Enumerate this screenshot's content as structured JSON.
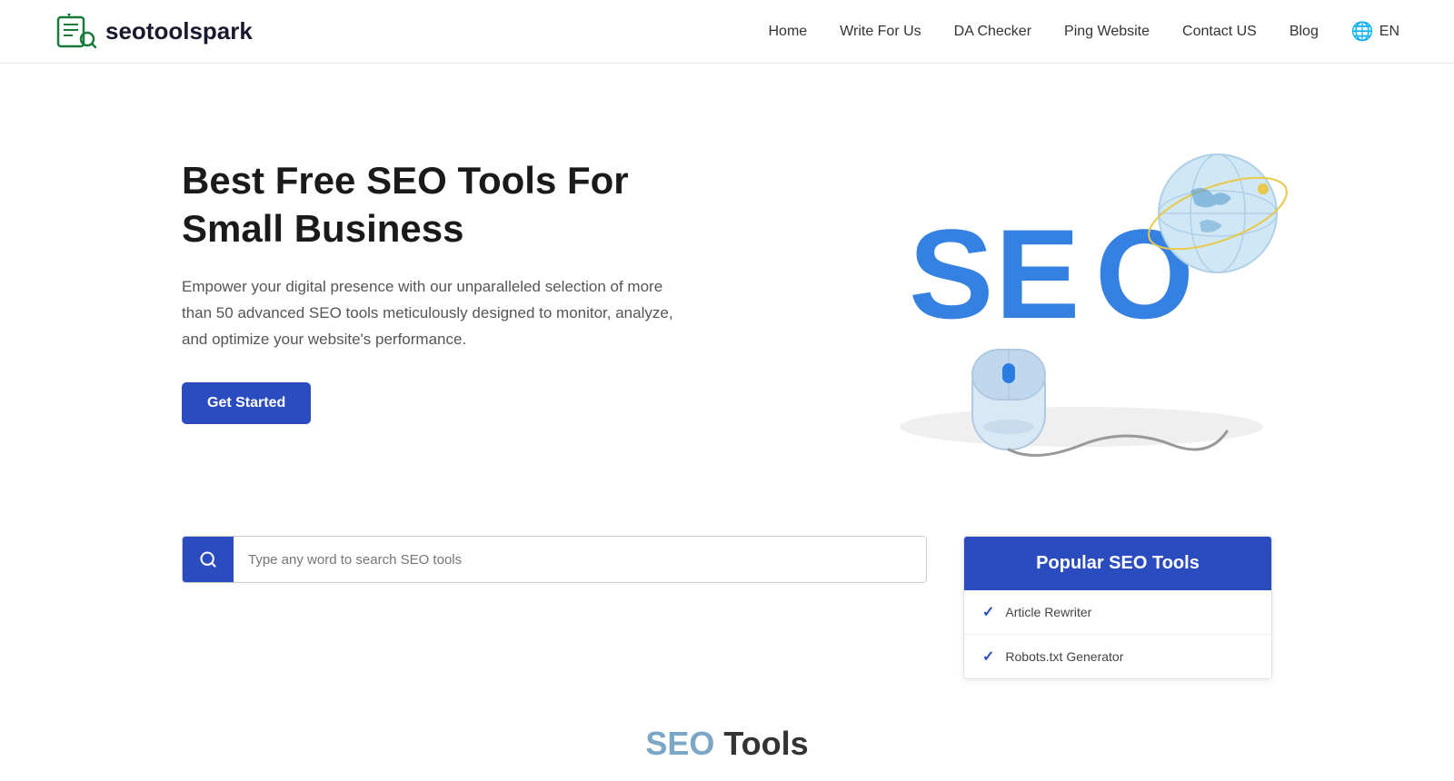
{
  "logo": {
    "text": "seotoolspark",
    "alt": "SEO Tool Spark Logo"
  },
  "nav": {
    "items": [
      {
        "label": "Home",
        "href": "#"
      },
      {
        "label": "Write For Us",
        "href": "#"
      },
      {
        "label": "DA Checker",
        "href": "#"
      },
      {
        "label": "Ping Website",
        "href": "#"
      },
      {
        "label": "Contact US",
        "href": "#"
      },
      {
        "label": "Blog",
        "href": "#"
      }
    ],
    "language": "EN"
  },
  "hero": {
    "title": "Best Free SEO Tools For Small Business",
    "description": "Empower your digital presence with our unparalleled selection of more than 50 advanced SEO tools meticulously designed to monitor, analyze, and optimize your website's performance.",
    "cta_label": "Get Started"
  },
  "search": {
    "placeholder": "Type any word to search SEO tools"
  },
  "popular_tools": {
    "header": "Popular SEO Tools",
    "items": [
      {
        "label": "Article Rewriter"
      },
      {
        "label": "Robots.txt Generator"
      }
    ]
  },
  "tools_section": {
    "seo_word": "SEO",
    "tools_word": " Tools"
  }
}
